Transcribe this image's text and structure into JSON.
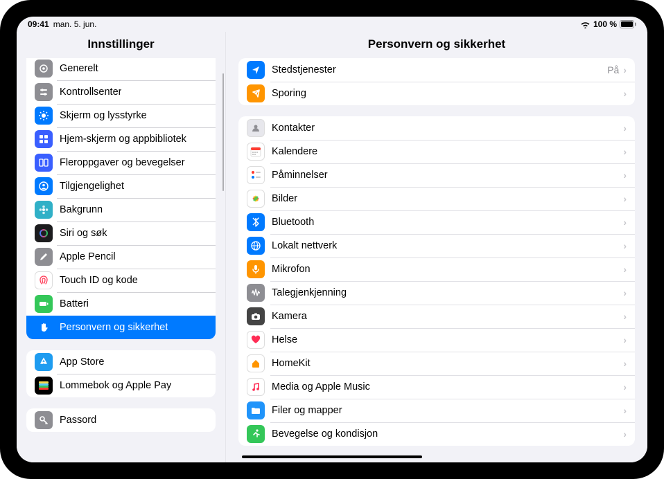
{
  "status": {
    "time": "09:41",
    "date": "man. 5. jun.",
    "battery": "100 %"
  },
  "sidebar": {
    "title": "Innstillinger",
    "group1": [
      {
        "label": "Generelt",
        "iconBg": "#8e8e93",
        "glyph": "gear"
      },
      {
        "label": "Kontrollsenter",
        "iconBg": "#8e8e93",
        "glyph": "sliders"
      },
      {
        "label": "Skjerm og lysstyrke",
        "iconBg": "#007aff",
        "glyph": "sun"
      },
      {
        "label": "Hjem-skjerm og appbibliotek",
        "iconBg": "#3a5fff",
        "glyph": "grid"
      },
      {
        "label": "Fleroppgaver og bevegelser",
        "iconBg": "#3a5fff",
        "glyph": "multi"
      },
      {
        "label": "Tilgjengelighet",
        "iconBg": "#007aff",
        "glyph": "person"
      },
      {
        "label": "Bakgrunn",
        "iconBg": "#30b0c7",
        "glyph": "flower"
      },
      {
        "label": "Siri og søk",
        "iconBg": "grad",
        "glyph": "siri"
      },
      {
        "label": "Apple Pencil",
        "iconBg": "#8e8e93",
        "glyph": "pencil"
      },
      {
        "label": "Touch ID og kode",
        "iconBg": "#ffffff",
        "glyph": "touch"
      },
      {
        "label": "Batteri",
        "iconBg": "#34c759",
        "glyph": "battery"
      },
      {
        "label": "Personvern og sikkerhet",
        "iconBg": "#007aff",
        "glyph": "hand",
        "selected": true
      }
    ],
    "group2": [
      {
        "label": "App Store",
        "iconBg": "#1e9cf0",
        "glyph": "appstore"
      },
      {
        "label": "Lommebok og Apple Pay",
        "iconBg": "#000000",
        "glyph": "wallet"
      }
    ],
    "group3": [
      {
        "label": "Passord",
        "iconBg": "#8e8e93",
        "glyph": "key"
      }
    ]
  },
  "detail": {
    "title": "Personvern og sikkerhet",
    "group1": [
      {
        "label": "Stedstjenester",
        "iconBg": "#007aff",
        "glyph": "location",
        "value": "På"
      },
      {
        "label": "Sporing",
        "iconBg": "#ff9500",
        "glyph": "tracking"
      }
    ],
    "group2": [
      {
        "label": "Kontakter",
        "iconBg": "#e7e7ec",
        "glyph": "contacts"
      },
      {
        "label": "Kalendere",
        "iconBg": "#ffffff",
        "glyph": "calendar"
      },
      {
        "label": "Påminnelser",
        "iconBg": "#ffffff",
        "glyph": "reminders"
      },
      {
        "label": "Bilder",
        "iconBg": "#ffffff",
        "glyph": "photos"
      },
      {
        "label": "Bluetooth",
        "iconBg": "#007aff",
        "glyph": "bluetooth"
      },
      {
        "label": "Lokalt nettverk",
        "iconBg": "#007aff",
        "glyph": "globe"
      },
      {
        "label": "Mikrofon",
        "iconBg": "#ff9500",
        "glyph": "mic"
      },
      {
        "label": "Talegjenkjenning",
        "iconBg": "#8e8e93",
        "glyph": "wave"
      },
      {
        "label": "Kamera",
        "iconBg": "#444444",
        "glyph": "camera"
      },
      {
        "label": "Helse",
        "iconBg": "#ffffff",
        "glyph": "heart"
      },
      {
        "label": "HomeKit",
        "iconBg": "#ffffff",
        "glyph": "home"
      },
      {
        "label": "Media og Apple Music",
        "iconBg": "#ffffff",
        "glyph": "music"
      },
      {
        "label": "Filer og mapper",
        "iconBg": "#2094fa",
        "glyph": "folder"
      },
      {
        "label": "Bevegelse og kondisjon",
        "iconBg": "#34c759",
        "glyph": "fitness"
      }
    ]
  }
}
